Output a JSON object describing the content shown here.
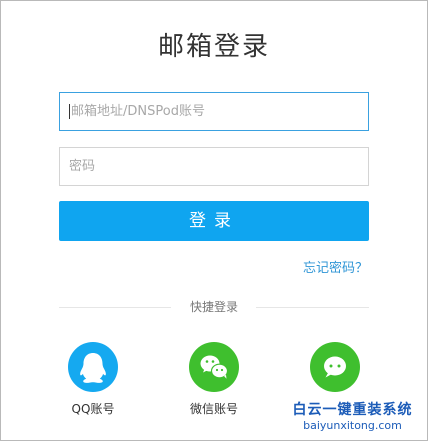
{
  "page": {
    "title": "邮箱登录"
  },
  "form": {
    "email_placeholder": "邮箱地址/DNSPod账号",
    "password_placeholder": "密码",
    "login_label": "登录",
    "forgot_label": "忘记密码？"
  },
  "quick_login": {
    "label": "快捷登录",
    "options": [
      {
        "label": "QQ账号",
        "icon": "qq-penguin-icon",
        "color": "#15a9f0"
      },
      {
        "label": "微信账号",
        "icon": "wechat-icon",
        "color": "#3fbf2e"
      },
      {
        "label": "",
        "icon": "chat-bubble-icon",
        "color": "#3fbf2e"
      }
    ]
  },
  "watermark": {
    "title": "白云一键重装系统",
    "url": "baiyunxitong.com"
  },
  "colors": {
    "accent": "#0fa5f0",
    "link": "#3096d6",
    "focus_border": "#3aa1e0"
  }
}
